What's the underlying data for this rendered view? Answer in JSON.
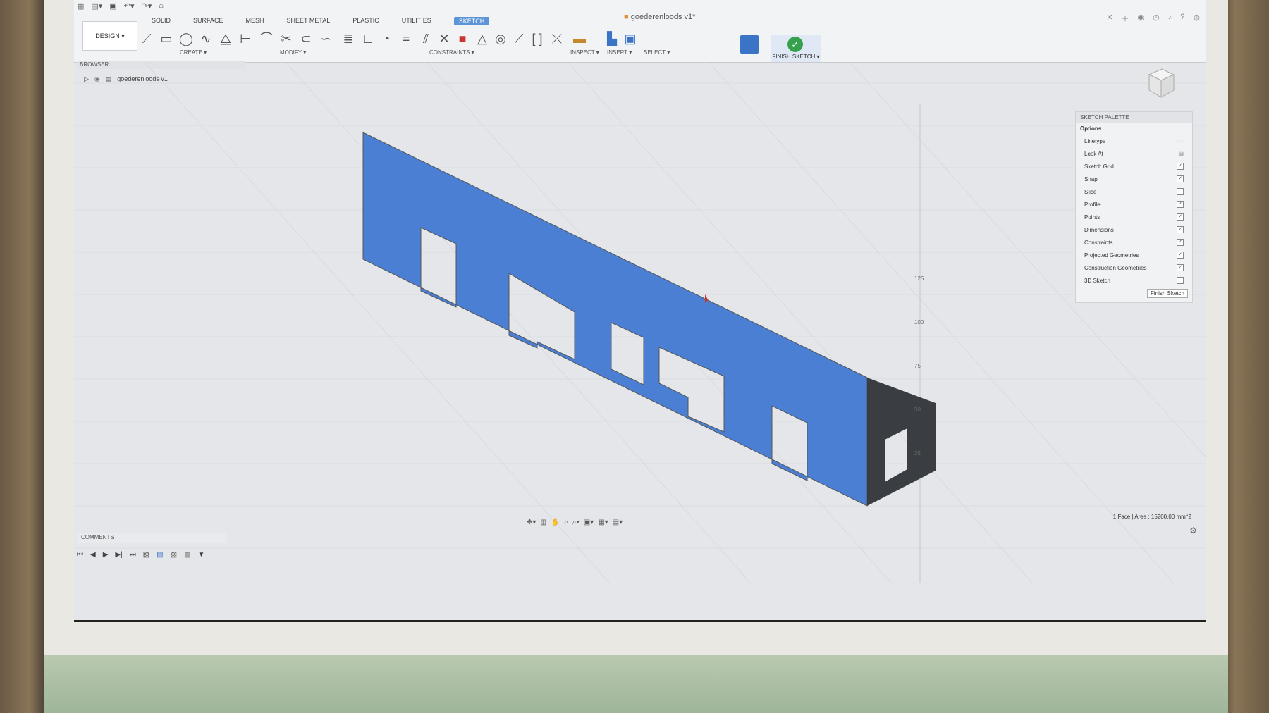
{
  "app": {
    "document_title": "goederenloods v1*",
    "design_label": "DESIGN ▾"
  },
  "tabs": [
    {
      "label": "SOLID"
    },
    {
      "label": "SURFACE"
    },
    {
      "label": "MESH"
    },
    {
      "label": "SHEET METAL"
    },
    {
      "label": "PLASTIC"
    },
    {
      "label": "UTILITIES"
    },
    {
      "label": "SKETCH"
    }
  ],
  "groups": {
    "create": "CREATE ▾",
    "modify": "MODIFY ▾",
    "constraints": "CONSTRAINTS ▾",
    "inspect": "INSPECT ▾",
    "insert": "INSERT ▾",
    "select": "SELECT ▾",
    "finish": "FINISH SKETCH ▾"
  },
  "browser": {
    "title": "BROWSER",
    "item": "goederenloods v1"
  },
  "palette": {
    "title": "SKETCH PALETTE",
    "section": "Options",
    "rows": [
      {
        "label": "Linetype",
        "checked": ""
      },
      {
        "label": "Look At",
        "checked": ""
      },
      {
        "label": "Sketch Grid",
        "checked": "✓"
      },
      {
        "label": "Snap",
        "checked": "✓"
      },
      {
        "label": "Slice",
        "checked": ""
      },
      {
        "label": "Profile",
        "checked": "✓"
      },
      {
        "label": "Points",
        "checked": "✓"
      },
      {
        "label": "Dimensions",
        "checked": "✓"
      },
      {
        "label": "Constraints",
        "checked": "✓"
      },
      {
        "label": "Projected Geometries",
        "checked": "✓"
      },
      {
        "label": "Construction Geometries",
        "checked": "✓"
      },
      {
        "label": "3D Sketch",
        "checked": ""
      }
    ],
    "finish_label": "Finish Sketch"
  },
  "status": {
    "text": "1 Face | Area : 15200.00 mm^2"
  },
  "comments": {
    "title": "COMMENTS"
  },
  "axis_ticks": [
    "125",
    "100",
    "75",
    "50",
    "25"
  ],
  "colors": {
    "sketch_face": "#4a7fd4",
    "end_panel": "#3a3d42",
    "accent": "#5d94d8"
  }
}
